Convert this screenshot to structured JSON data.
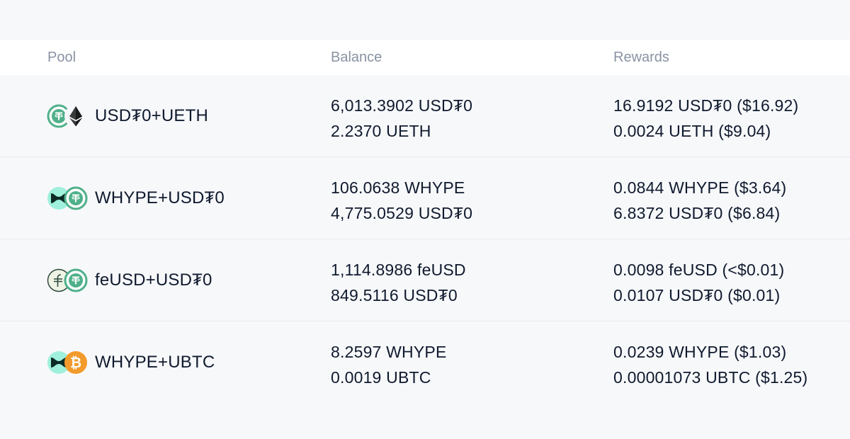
{
  "header": {
    "pool": "Pool",
    "balance": "Balance",
    "rewards": "Rewards"
  },
  "colors": {
    "usdt_green": "#4fb08a",
    "whype_mint": "#9ff0dc",
    "btc_orange": "#f39a2c",
    "feusd_cream": "#eef3e6",
    "eth_dark": "#2b2b2b"
  },
  "rows": [
    {
      "pool": "USD₮0+UETH",
      "icons": [
        "usdt0-icon",
        "eth-icon"
      ],
      "balance": [
        "6,013.3902 USD₮0",
        "2.2370 UETH"
      ],
      "rewards": [
        "16.9192 USD₮0 ($16.92)",
        "0.0024 UETH ($9.04)"
      ]
    },
    {
      "pool": "WHYPE+USD₮0",
      "icons": [
        "whype-icon",
        "usdt0-icon"
      ],
      "balance": [
        "106.0638 WHYPE",
        "4,775.0529 USD₮0"
      ],
      "rewards": [
        "0.0844 WHYPE ($3.64)",
        "6.8372 USD₮0 ($6.84)"
      ]
    },
    {
      "pool": "feUSD+USD₮0",
      "icons": [
        "feusd-icon",
        "usdt0-icon"
      ],
      "balance": [
        "1,114.8986 feUSD",
        "849.5116 USD₮0"
      ],
      "rewards": [
        "0.0098 feUSD (<$0.01)",
        "0.0107 USD₮0 ($0.01)"
      ]
    },
    {
      "pool": "WHYPE+UBTC",
      "icons": [
        "whype-icon",
        "btc-icon"
      ],
      "balance": [
        "8.2597 WHYPE",
        "0.0019 UBTC"
      ],
      "rewards": [
        "0.0239 WHYPE ($1.03)",
        "0.00001073 UBTC ($1.25)"
      ]
    }
  ]
}
